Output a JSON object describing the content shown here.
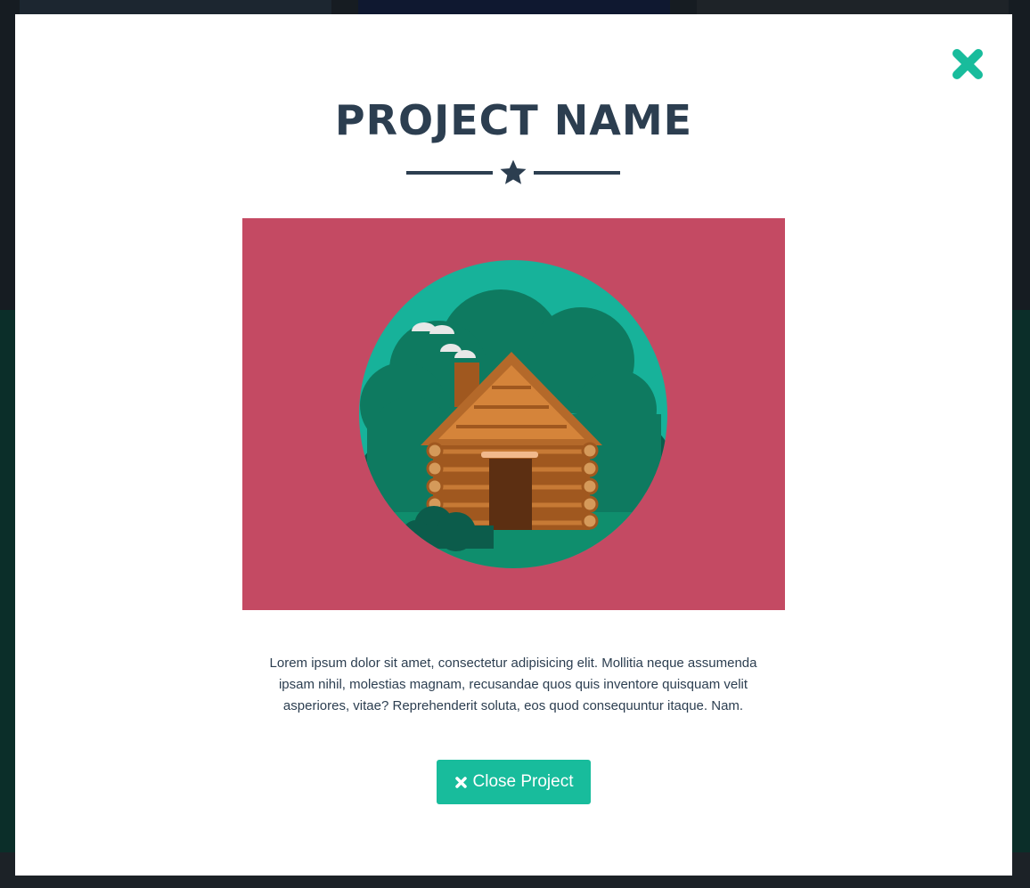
{
  "modal": {
    "title": "PROJECT NAME",
    "description": "Lorem ipsum dolor sit amet, consectetur adipisicing elit. Mollitia neque assumenda ipsam nihil, molestias magnam, recusandae quos quis inventore quisquam velit asperiores, vitae? Reprehenderit soluta, eos quod consequuntur itaque. Nam.",
    "close_button_label": "Close Project",
    "close_icon": "times-icon",
    "divider_icon": "star-icon",
    "image_subject": "log-cabin-illustration"
  },
  "colors": {
    "heading": "#2c3e50",
    "accent": "#18bc9c",
    "image_background": "#c44a63",
    "modal_background": "#ffffff"
  }
}
